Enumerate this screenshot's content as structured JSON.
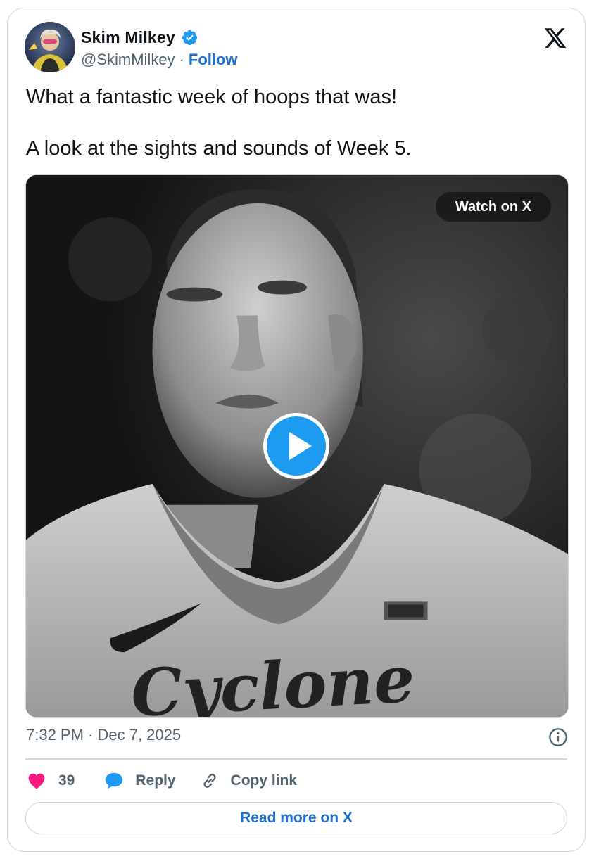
{
  "author": {
    "name": "Skim Milkey",
    "handle": "@SkimMilkey",
    "separator": "·",
    "follow_label": "Follow"
  },
  "tweet": {
    "line1": "What a fantastic week of hoops that was!",
    "line2": "A look at the sights and sounds of Week 5."
  },
  "media": {
    "watch_label": "Watch on X",
    "jersey_text": "Cyclone"
  },
  "meta": {
    "timestamp": "7:32 PM · Dec 7, 2025"
  },
  "actions": {
    "likes_count": "39",
    "reply_label": "Reply",
    "copy_label": "Copy link"
  },
  "footer": {
    "read_more_label": "Read more on X"
  },
  "icons": {
    "x_logo": "x-logo-icon",
    "verified": "verified-badge-icon",
    "info": "info-icon",
    "heart": "heart-icon",
    "reply": "speech-bubble-icon",
    "copy": "link-icon",
    "play": "play-icon"
  },
  "colors": {
    "accent": "#1d6fd0",
    "verified": "#1d9bf0",
    "heart": "#f91880",
    "secondary_text": "#536471",
    "border": "#cfd9de"
  }
}
